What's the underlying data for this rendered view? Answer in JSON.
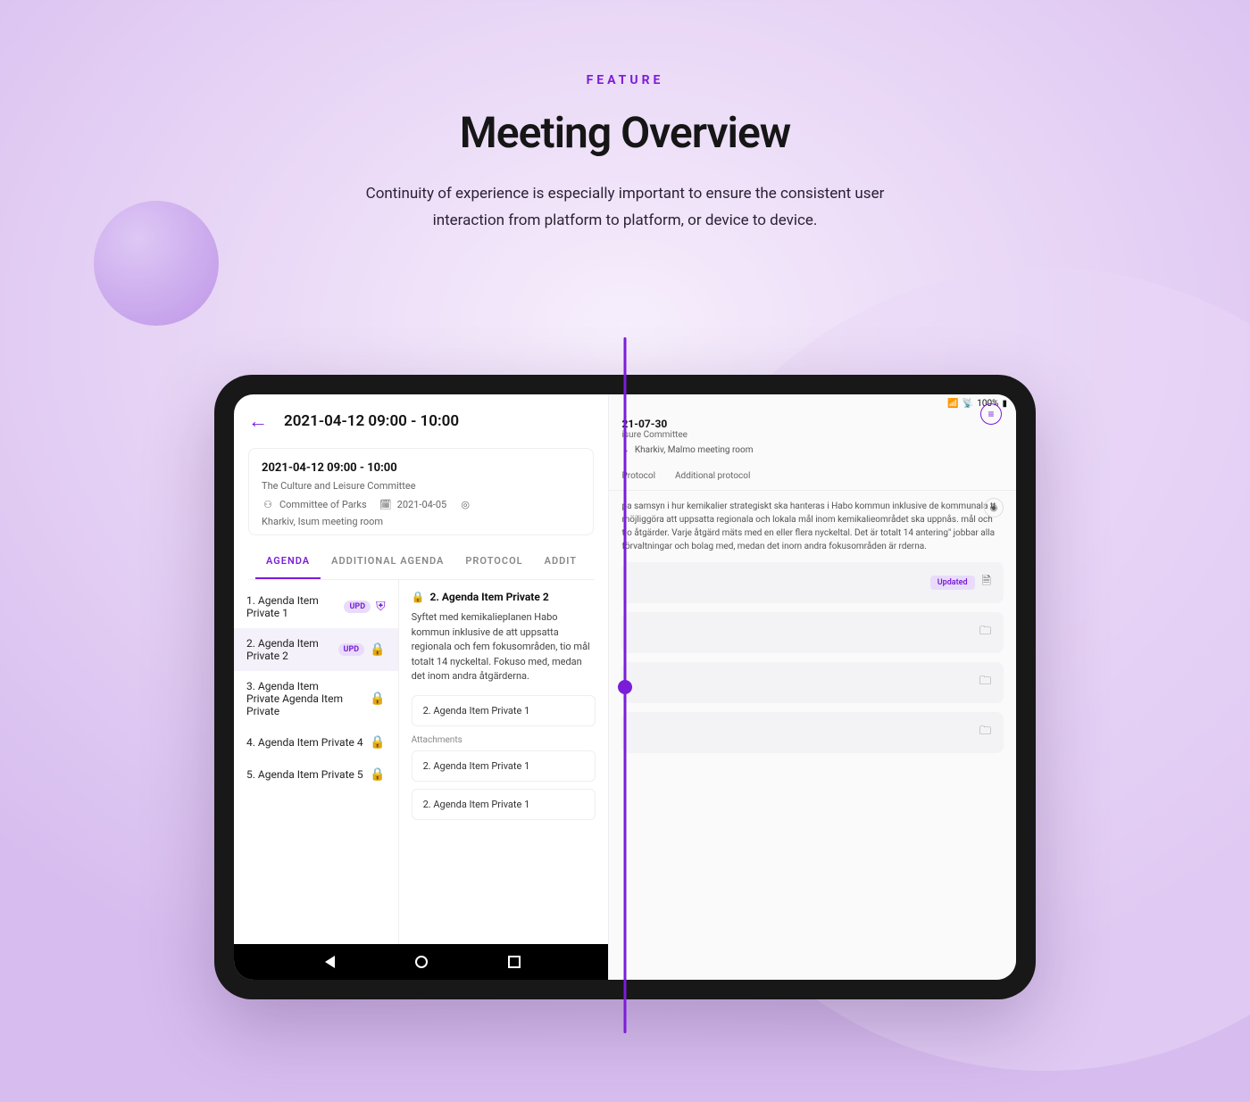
{
  "hero": {
    "eyebrow": "FEATURE",
    "title": "Meeting Overview",
    "subtitle": "Continuity of experience is especially important to ensure the consistent user interaction from platform to platform, or device to device."
  },
  "left": {
    "topbar_title": "2021-04-12 09:00 - 10:00",
    "meta": {
      "title": "2021-04-12 09:00 - 10:00",
      "subtitle": "The Culture and Leisure Committee",
      "org": "Committee of Parks",
      "date": "2021-04-05",
      "location": "Kharkiv, Isum meeting room"
    },
    "tabs": [
      "AGENDA",
      "ADDITIONAL AGENDA",
      "PROTOCOL",
      "ADDIT"
    ],
    "active_tab": 0,
    "items": [
      {
        "label": "1. Agenda Item Private 1",
        "badge": "UPD",
        "icon": "shield"
      },
      {
        "label": "2. Agenda Item Private 2",
        "badge": "UPD",
        "icon": "lock"
      },
      {
        "label": "3. Agenda Item Private Agenda Item Private",
        "badge": "",
        "icon": "lock"
      },
      {
        "label": "4. Agenda Item Private 4",
        "badge": "",
        "icon": "lock"
      },
      {
        "label": "5. Agenda Item Private 5",
        "badge": "",
        "icon": "lock"
      }
    ],
    "selected_index": 1,
    "detail": {
      "title": "2. Agenda Item Private 2",
      "body": "Syftet med kemikalieplanen Habo kommun inklusive de att uppsatta regionala och fem fokusområden, tio mål totalt 14 nyckeltal. Fokuso med, medan det inom andra åtgärderna.",
      "sub_cards": [
        "2. Agenda Item Private 1"
      ],
      "attachments_label": "Attachments",
      "attachments": [
        "2. Agenda Item Private 1",
        "2. Agenda Item Private 1"
      ]
    }
  },
  "right": {
    "status": {
      "signal": "•ıl",
      "wifi": "⌃",
      "battery": "100%"
    },
    "date": "21-07-30",
    "subtitle": "isure Committee",
    "location": "Kharkiv, Malmo meeting room",
    "tabs": [
      "Protocol",
      "Additional protocol"
    ],
    "description": "pa samsyn i hur kemikalier strategiskt ska hanteras i Habo kommun inklusive de kommunala tt möjliggöra att uppsatta regionala och lokala mål inom kemikalieområdet ska uppnås. mål och tio åtgärder. Varje åtgärd mäts med en eller flera nyckeltal. Det är totalt 14 antering\" jobbar alla förvaltningar och bolag med, medan det inom andra fokusområden är rderna.",
    "rows": [
      {
        "label": "",
        "badge": "Updated",
        "icon": "doc"
      },
      {
        "label": "",
        "badge": "",
        "icon": "folder"
      },
      {
        "label": "",
        "badge": "",
        "icon": "folder"
      },
      {
        "label": "",
        "badge": "",
        "icon": "folder"
      }
    ]
  }
}
